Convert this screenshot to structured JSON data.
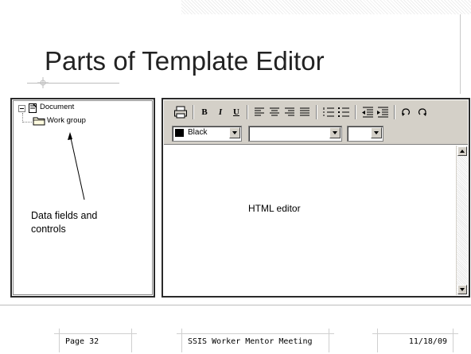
{
  "slide": {
    "title": "Parts of Template Editor"
  },
  "tree": {
    "root_label": "Document",
    "child_label": "Work group"
  },
  "annotations": {
    "data_fields": "Data fields and\ncontrols",
    "html_editor": "HTML editor"
  },
  "toolbar": {
    "bold": "B",
    "italic": "I",
    "underline": "U",
    "font_color": "Black"
  },
  "footer": {
    "page": "Page 32",
    "meeting": "SSIS Worker Mentor Meeting",
    "date": "11/18/09"
  },
  "icons": [
    "print-icon",
    "align-left-icon",
    "align-center-icon",
    "align-right-icon",
    "justify-icon",
    "numbered-list-icon",
    "bullet-list-icon",
    "outdent-icon",
    "indent-icon",
    "undo-icon",
    "redo-icon",
    "document-icon",
    "folder-icon"
  ],
  "colors": {
    "toolbar_bg": "#d4d0c8",
    "border": "#2a2a2a",
    "swatch": "#000000"
  }
}
